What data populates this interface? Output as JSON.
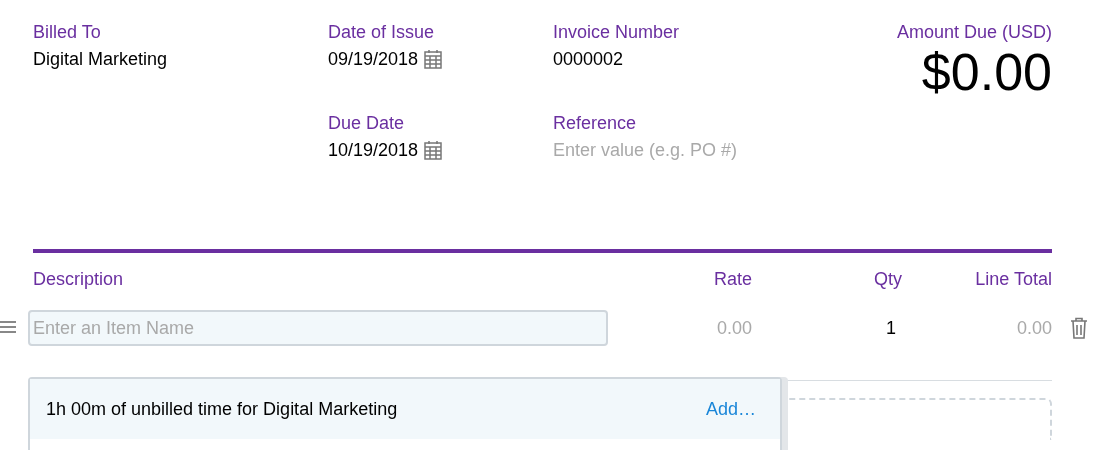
{
  "fields": [
    {
      "label": "Billed To",
      "value": "Digital Marketing"
    },
    {
      "label": "Date of Issue",
      "value": "09/19/2018",
      "kind": "date"
    },
    {
      "label": "Invoice Number",
      "value": "0000002"
    },
    {
      "label": "Due Date",
      "value": "10/19/2018",
      "kind": "date"
    },
    {
      "label": "Reference",
      "placeholder": "Enter value (e.g. PO #)",
      "kind": "input"
    }
  ],
  "amount_due": {
    "label": "Amount Due (USD)",
    "value": "$0.00"
  },
  "table": {
    "columns": [
      "Description",
      "Rate",
      "Qty",
      "Line Total"
    ],
    "rows": [
      {
        "item_placeholder": "Enter an Item Name",
        "rate": "0.00",
        "qty": "1",
        "line_total": "0.00"
      }
    ]
  },
  "suggestions": [
    {
      "text": "1h 00m of unbilled time for Digital Marketing",
      "action": "Add…",
      "selected": true
    }
  ]
}
